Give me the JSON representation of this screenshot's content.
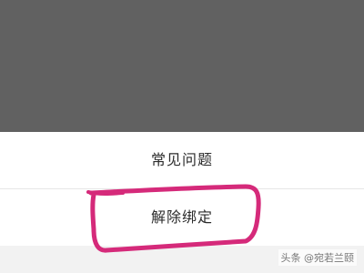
{
  "menu": {
    "items": [
      {
        "label": "常见问题"
      },
      {
        "label": "解除绑定"
      }
    ]
  },
  "annotation": {
    "color": "#d52a7a"
  },
  "watermark": "头条 @宛若兰颐"
}
